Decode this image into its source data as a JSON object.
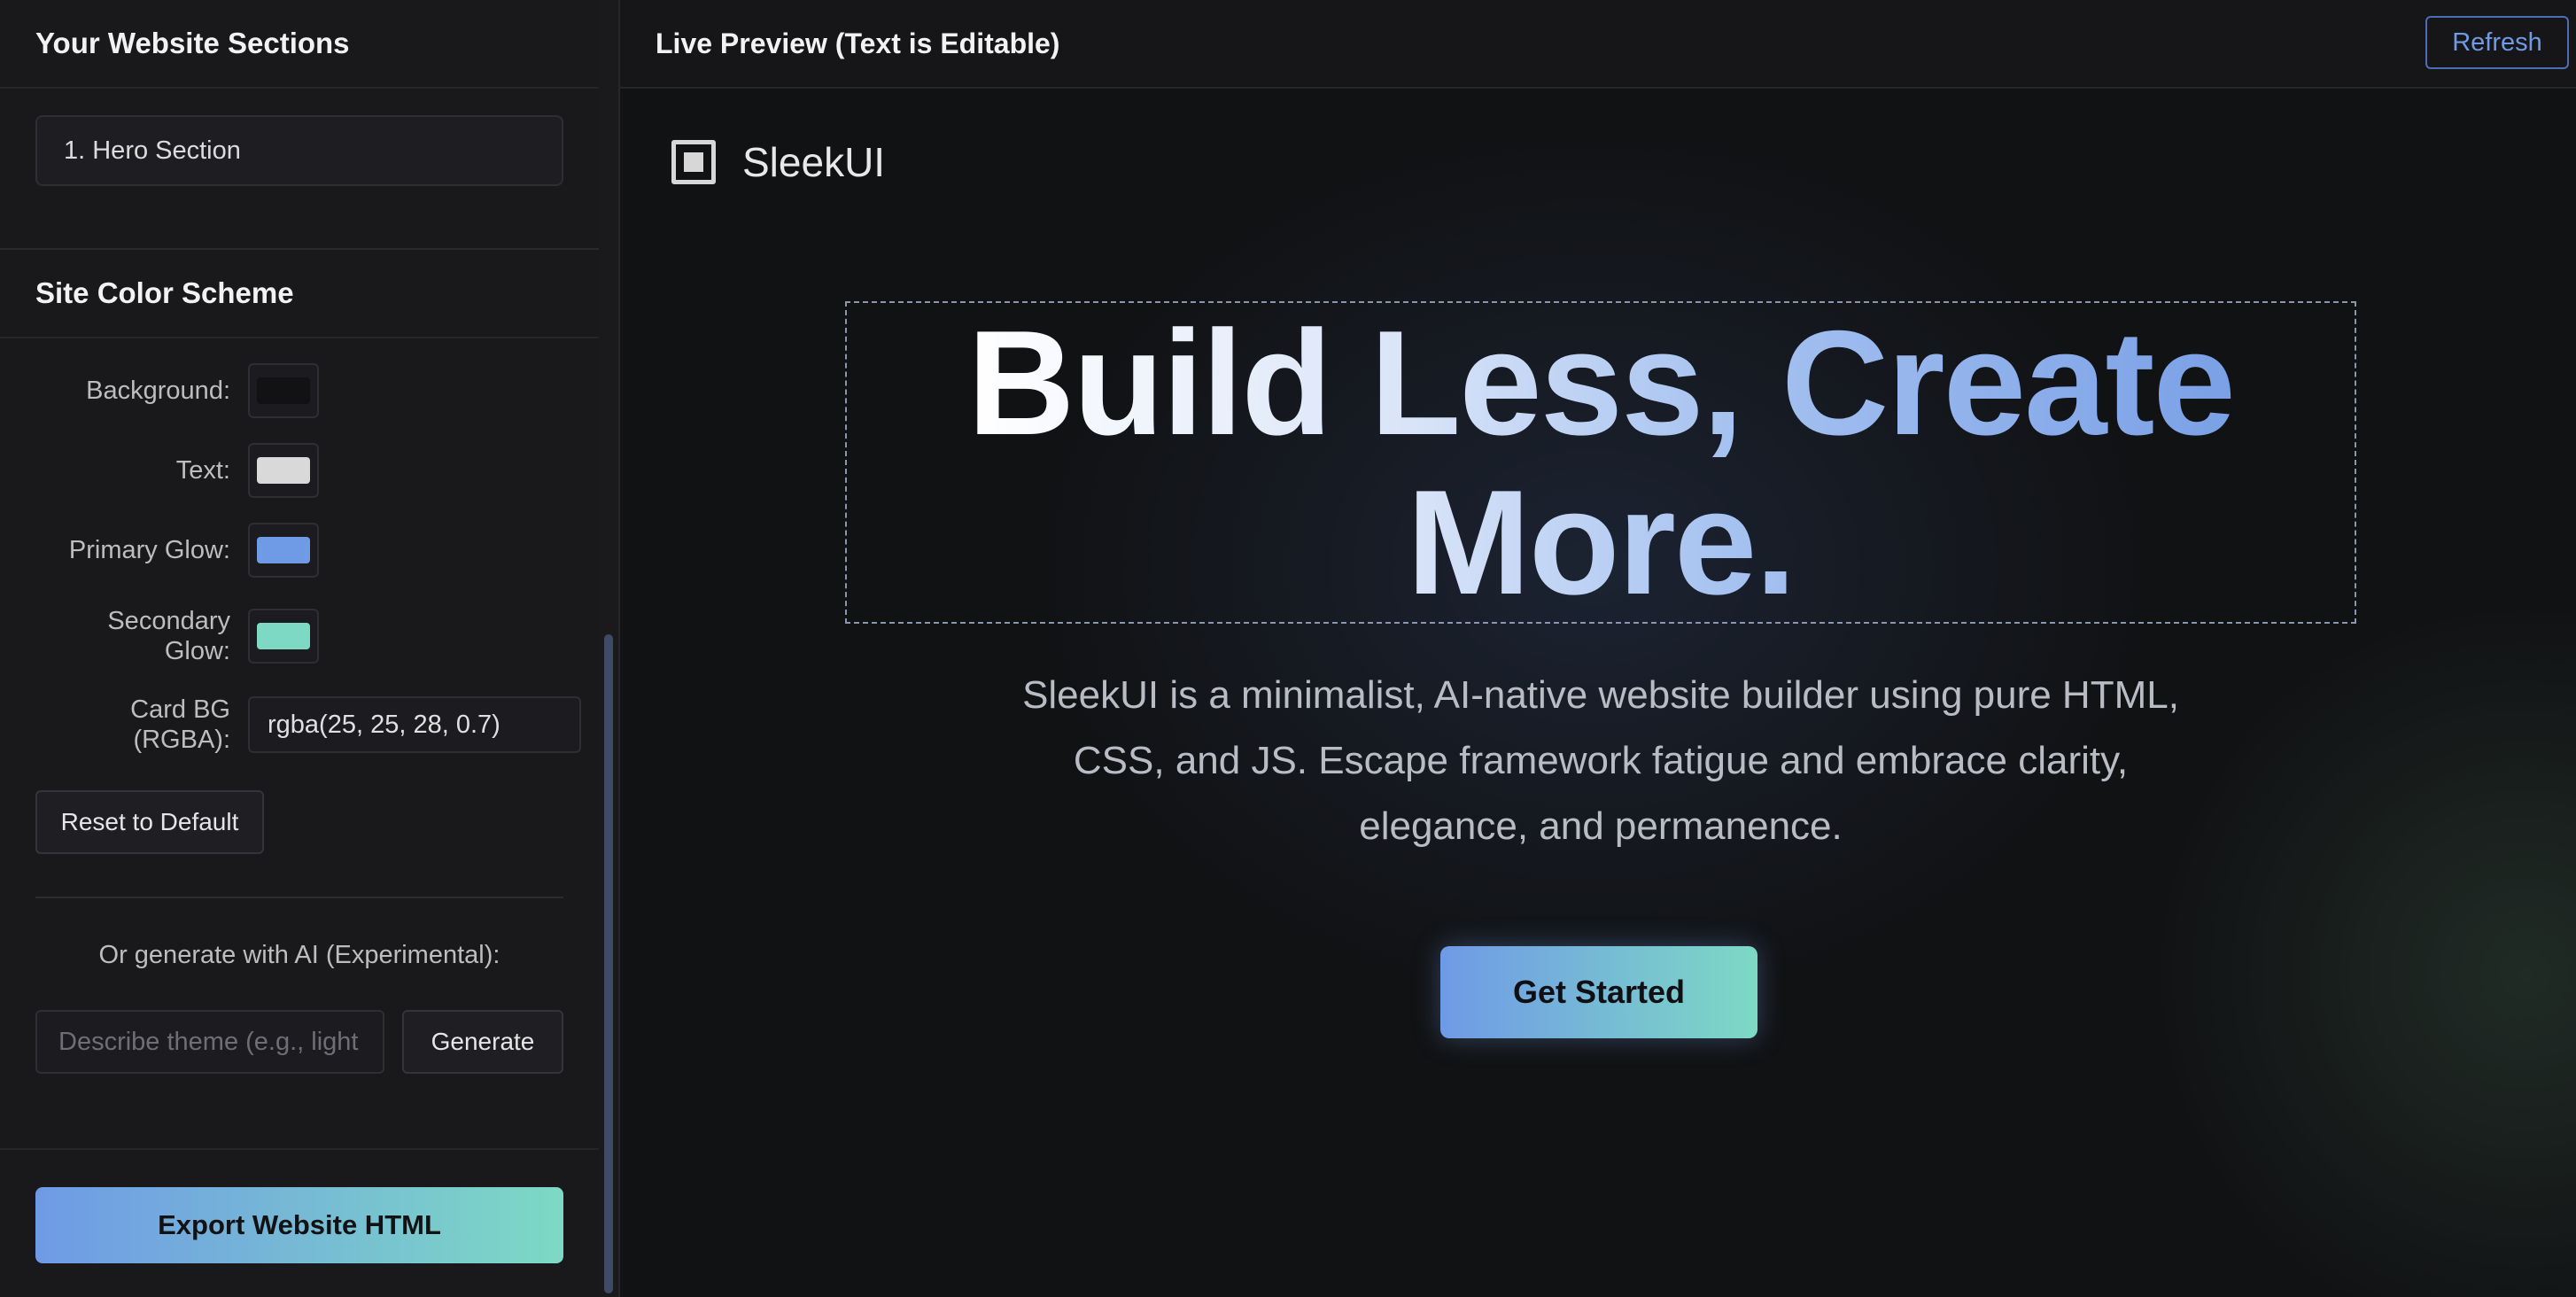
{
  "sidebar": {
    "sections_title": "Your Website Sections",
    "sections": [
      {
        "label": "1. Hero Section"
      }
    ],
    "color_scheme_title": "Site Color Scheme",
    "colors": {
      "background": {
        "label": "Background:",
        "value": "#121214"
      },
      "text": {
        "label": "Text:",
        "value": "#d9d9d9"
      },
      "primary_glow": {
        "label": "Primary Glow:",
        "value": "#6f9ae6"
      },
      "secondary_glow": {
        "label_line1": "Secondary",
        "label_line2": "Glow:",
        "value": "#7dd9c4"
      },
      "card_bg": {
        "label_line1": "Card BG",
        "label_line2": "(RGBA):",
        "value": "rgba(25, 25, 28, 0.7)"
      }
    },
    "reset_label": "Reset to Default",
    "ai_label": "Or generate with AI (Experimental):",
    "ai_placeholder": "Describe theme (e.g., light",
    "generate_label": "Generate",
    "export_label": "Export Website HTML"
  },
  "preview": {
    "title": "Live Preview (Text is Editable)",
    "refresh_label": "Refresh",
    "site": {
      "logo_text": "SleekUI",
      "headline_line1": "Build Less, Create",
      "headline_line2": "More.",
      "subtext": "SleekUI is a minimalist, AI-native website builder using pure HTML, CSS, and JS. Escape framework fatigue and embrace clarity, elegance, and permanence.",
      "cta_label": "Get Started"
    }
  },
  "theme": {
    "accent_gradient_start": "#6f9ae6",
    "accent_gradient_end": "#7dd9c4"
  }
}
